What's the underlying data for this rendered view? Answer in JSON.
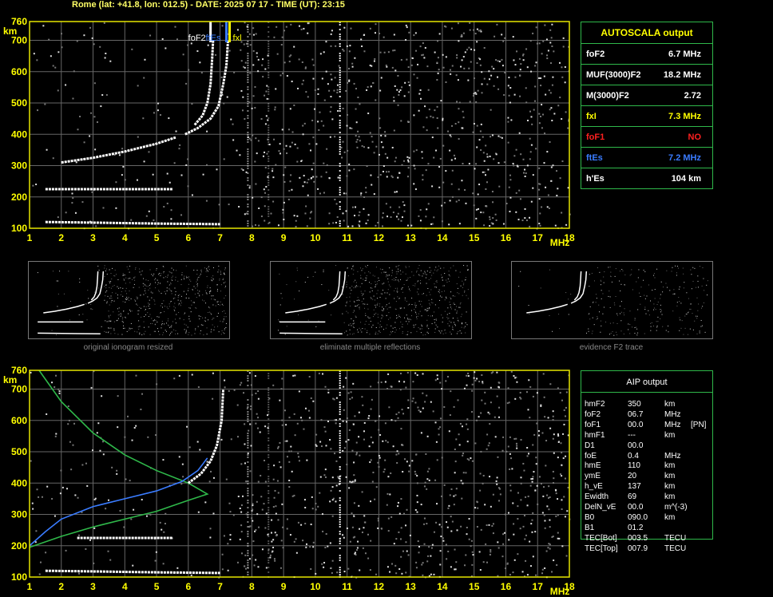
{
  "header": "Rome (lat: +41.8, lon: 012.5) - DATE: 2025 07 17 - TIME (UT): 23:15",
  "colors": {
    "axis": "#e6e600",
    "grid": "#666666",
    "green": "#2fb84a",
    "yellow": "#ffff00",
    "red": "#ff2020",
    "blue": "#3a7cff"
  },
  "chart_data": [
    {
      "type": "scatter",
      "title": "",
      "xlabel": "MHz",
      "ylabel": "km",
      "x_ticks": [
        1,
        2,
        3,
        4,
        5,
        6,
        7,
        8,
        9,
        10,
        11,
        12,
        13,
        14,
        15,
        16,
        17,
        18
      ],
      "y_ticks": [
        100,
        200,
        300,
        400,
        500,
        600,
        700,
        760
      ],
      "xlim": [
        1,
        18
      ],
      "ylim": [
        100,
        760
      ],
      "grid": true,
      "markers": [
        {
          "label": "foF2",
          "x": 6.7,
          "color": "#ffffff"
        },
        {
          "label": "ftEs",
          "x": 7.2,
          "color": "#3a7cff"
        },
        {
          "label": "fxl",
          "x": 7.3,
          "color": "#ffff00"
        }
      ],
      "series": [
        {
          "color": "#ffffff",
          "points": [
            [
              6.2,
              430
            ],
            [
              6.45,
              460
            ],
            [
              6.6,
              500
            ],
            [
              6.7,
              560
            ],
            [
              6.75,
              640
            ],
            [
              6.78,
              700
            ]
          ]
        },
        {
          "color": "#ffffff",
          "points": [
            [
              5.9,
              400
            ],
            [
              6.3,
              420
            ],
            [
              6.7,
              450
            ],
            [
              6.95,
              490
            ],
            [
              7.1,
              560
            ],
            [
              7.2,
              620
            ],
            [
              7.25,
              700
            ]
          ]
        },
        {
          "color": "#ffffff",
          "points": [
            [
              2.0,
              310
            ],
            [
              3.0,
              325
            ],
            [
              4.0,
              345
            ],
            [
              5.0,
              370
            ],
            [
              5.6,
              390
            ]
          ]
        },
        {
          "color": "#ffffff",
          "points": [
            [
              1.5,
              120
            ],
            [
              3,
              118
            ],
            [
              5,
              115
            ],
            [
              7,
              113
            ]
          ]
        },
        {
          "color": "#ffffff",
          "points": [
            [
              1.5,
              225
            ],
            [
              5.5,
              225
            ]
          ]
        }
      ]
    },
    {
      "type": "line",
      "title": "",
      "xlabel": "MHz",
      "ylabel": "km",
      "x_ticks": [
        1,
        2,
        3,
        4,
        5,
        6,
        7,
        8,
        9,
        10,
        11,
        12,
        13,
        14,
        15,
        16,
        17,
        18
      ],
      "y_ticks": [
        100,
        200,
        300,
        400,
        500,
        600,
        700,
        760
      ],
      "xlim": [
        1,
        18
      ],
      "ylim": [
        100,
        760
      ],
      "grid": true,
      "series": [
        {
          "color": "#2fb84a",
          "points": [
            [
              1.3,
              760
            ],
            [
              2.0,
              660
            ],
            [
              3.0,
              560
            ],
            [
              4.0,
              490
            ],
            [
              5.0,
              440
            ],
            [
              6.0,
              400
            ],
            [
              6.6,
              365
            ],
            [
              6.0,
              345
            ],
            [
              5.0,
              310
            ],
            [
              4.0,
              285
            ],
            [
              3.0,
              260
            ],
            [
              2.0,
              230
            ],
            [
              1.0,
              195
            ]
          ]
        },
        {
          "color": "#3a7cff",
          "points": [
            [
              1.0,
              200
            ],
            [
              1.5,
              245
            ],
            [
              2.0,
              285
            ],
            [
              3.0,
              325
            ],
            [
              4.0,
              350
            ],
            [
              5.0,
              375
            ],
            [
              5.8,
              405
            ],
            [
              6.3,
              440
            ],
            [
              6.6,
              480
            ]
          ]
        },
        {
          "color": "#ffffff",
          "points": [
            [
              6.0,
              400
            ],
            [
              6.4,
              430
            ],
            [
              6.7,
              470
            ],
            [
              6.9,
              520
            ],
            [
              7.05,
              600
            ],
            [
              7.1,
              700
            ]
          ]
        },
        {
          "color": "#ffffff",
          "points": [
            [
              1.5,
              120
            ],
            [
              3,
              118
            ],
            [
              5,
              115
            ],
            [
              7,
              113
            ]
          ]
        },
        {
          "color": "#ffffff",
          "points": [
            [
              2.5,
              225
            ],
            [
              5.5,
              225
            ]
          ]
        }
      ]
    }
  ],
  "autoscala": {
    "title": "AUTOSCALA output",
    "rows": [
      {
        "label": "foF2",
        "value": "6.7 MHz",
        "color": "#ffffff"
      },
      {
        "label": "MUF(3000)F2",
        "value": "18.2 MHz",
        "color": "#ffffff"
      },
      {
        "label": "M(3000)F2",
        "value": "2.72",
        "color": "#ffffff"
      },
      {
        "label": "fxI",
        "value": "7.3 MHz",
        "color": "#ffff00"
      },
      {
        "label": "foF1",
        "value": "NO",
        "color": "#ff2020"
      },
      {
        "label": "ftEs",
        "value": "7.2 MHz",
        "color": "#3a7cff"
      },
      {
        "label": "h'Es",
        "value": "104 km",
        "color": "#ffffff"
      }
    ]
  },
  "thumbnails": [
    {
      "caption": "original ionogram resized"
    },
    {
      "caption": "eliminate multiple reflections"
    },
    {
      "caption": "evidence F2 trace"
    }
  ],
  "aip": {
    "title": "AIP output",
    "rows": [
      {
        "name": "hmF2",
        "value": "350",
        "unit": "km",
        "extra": ""
      },
      {
        "name": "foF2",
        "value": "06.7",
        "unit": "MHz",
        "extra": ""
      },
      {
        "name": "foF1",
        "value": "00.0",
        "unit": "MHz",
        "extra": "[PN]"
      },
      {
        "name": "hmF1",
        "value": "---",
        "unit": "km",
        "extra": ""
      },
      {
        "name": "D1",
        "value": "00.0",
        "unit": "",
        "extra": ""
      },
      {
        "name": "foE",
        "value": "0.4",
        "unit": "MHz",
        "extra": ""
      },
      {
        "name": "hmE",
        "value": "110",
        "unit": "km",
        "extra": ""
      },
      {
        "name": "ymE",
        "value": "20",
        "unit": "km",
        "extra": ""
      },
      {
        "name": "h_vE",
        "value": "137",
        "unit": "km",
        "extra": ""
      },
      {
        "name": "Ewidth",
        "value": "69",
        "unit": "km",
        "extra": ""
      },
      {
        "name": "DelN_vE",
        "value": "00.0",
        "unit": "m^(-3)",
        "extra": ""
      },
      {
        "name": "B0",
        "value": "090.0",
        "unit": "km",
        "extra": ""
      },
      {
        "name": "B1",
        "value": "01.2",
        "unit": "",
        "extra": ""
      },
      {
        "name": "TEC[Bot]",
        "value": "003.5",
        "unit": "TECU",
        "extra": ""
      },
      {
        "name": "TEC[Top]",
        "value": "007.9",
        "unit": "TECU",
        "extra": ""
      }
    ]
  }
}
